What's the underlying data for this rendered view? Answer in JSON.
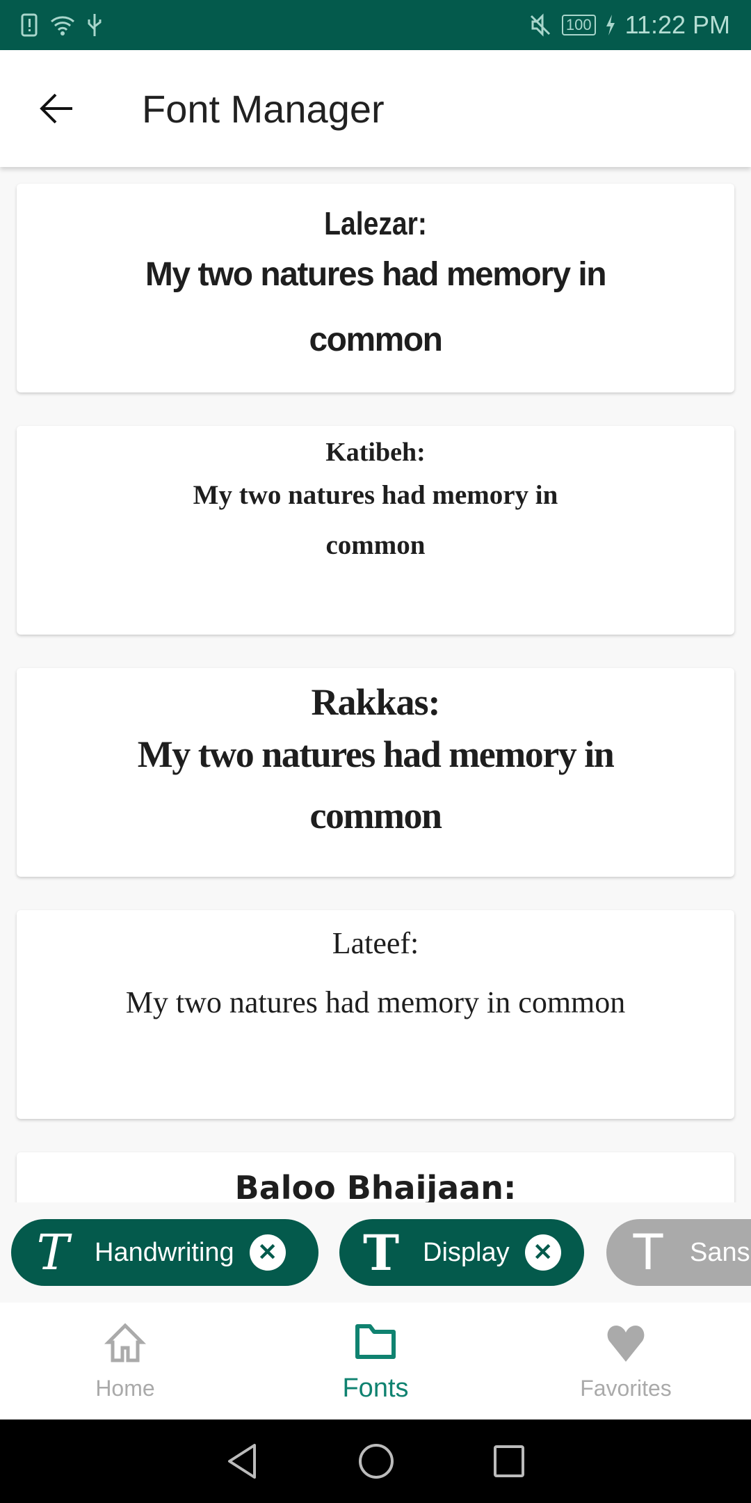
{
  "status_bar": {
    "time": "11:22 PM",
    "battery": "100",
    "icons": [
      "sim-alert-icon",
      "wifi-icon",
      "usb-icon",
      "mute-icon",
      "battery-icon",
      "charging-icon"
    ]
  },
  "app_bar": {
    "title": "Font Manager",
    "back_icon": "arrow-back-icon"
  },
  "font_cards": [
    {
      "name": "Lalezar:",
      "sample": "My two natures had memory in common"
    },
    {
      "name": "Katibeh:",
      "sample": "My two natures had memory in common"
    },
    {
      "name": "Rakkas:",
      "sample": "My two natures had memory in common"
    },
    {
      "name": "Lateef:",
      "sample": "My two natures had memory in common"
    },
    {
      "name": "Baloo Bhaijaan:",
      "sample": ""
    }
  ],
  "filter_chips": [
    {
      "label": "Handwriting",
      "icon": "handwriting-t-icon",
      "selected": true
    },
    {
      "label": "Display",
      "icon": "display-t-icon",
      "selected": true
    },
    {
      "label": "Sans",
      "icon": "sans-t-icon",
      "selected": false
    }
  ],
  "bottom_nav": {
    "items": [
      {
        "label": "Home",
        "icon": "home-icon",
        "active": false
      },
      {
        "label": "Fonts",
        "icon": "folder-icon",
        "active": true
      },
      {
        "label": "Favorites",
        "icon": "heart-icon",
        "active": false
      }
    ]
  },
  "colors": {
    "primary": "#045a4c",
    "accent": "#0f8270",
    "inactive": "#aaaaaa"
  }
}
